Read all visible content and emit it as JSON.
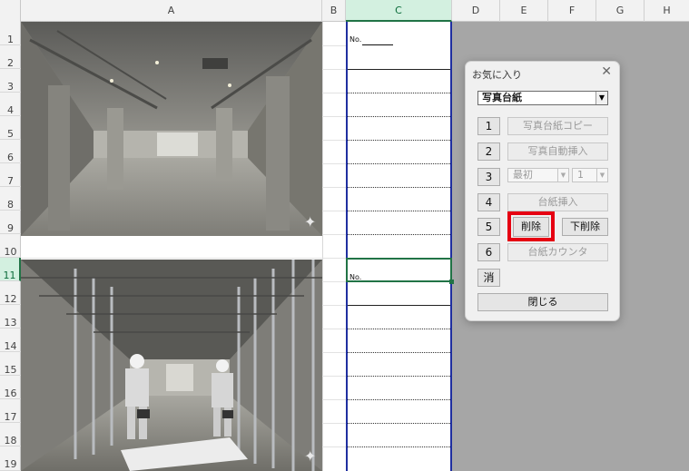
{
  "columns": [
    "A",
    "B",
    "C",
    "D",
    "E",
    "F",
    "G",
    "H"
  ],
  "rows": [
    "1",
    "2",
    "3",
    "4",
    "5",
    "6",
    "7",
    "8",
    "9",
    "10",
    "11",
    "12",
    "13",
    "14",
    "15",
    "16",
    "17",
    "18",
    "19"
  ],
  "cells": {
    "c1": "No.",
    "c11": "No."
  },
  "dialog": {
    "title": "お気に入り",
    "close": "✕",
    "combo_value": "写真台紙",
    "btn1_num": "1",
    "btn1_label": "写真台紙コピー",
    "btn2_num": "2",
    "btn2_label": "写真自動挿入",
    "btn3_num": "3",
    "btn3_select": "最初",
    "btn3_count": "1",
    "btn4_num": "4",
    "btn4_label": "台紙挿入",
    "btn5_num": "5",
    "btn5_delete": "削除",
    "btn5_lower_delete": "下削除",
    "btn6_num": "6",
    "btn6_label": "台紙カウンタ",
    "erase": "消",
    "close_button": "閉じる"
  },
  "colors": {
    "highlight": "#e60012",
    "selection": "#217346",
    "print_border": "#1f2fa0"
  }
}
